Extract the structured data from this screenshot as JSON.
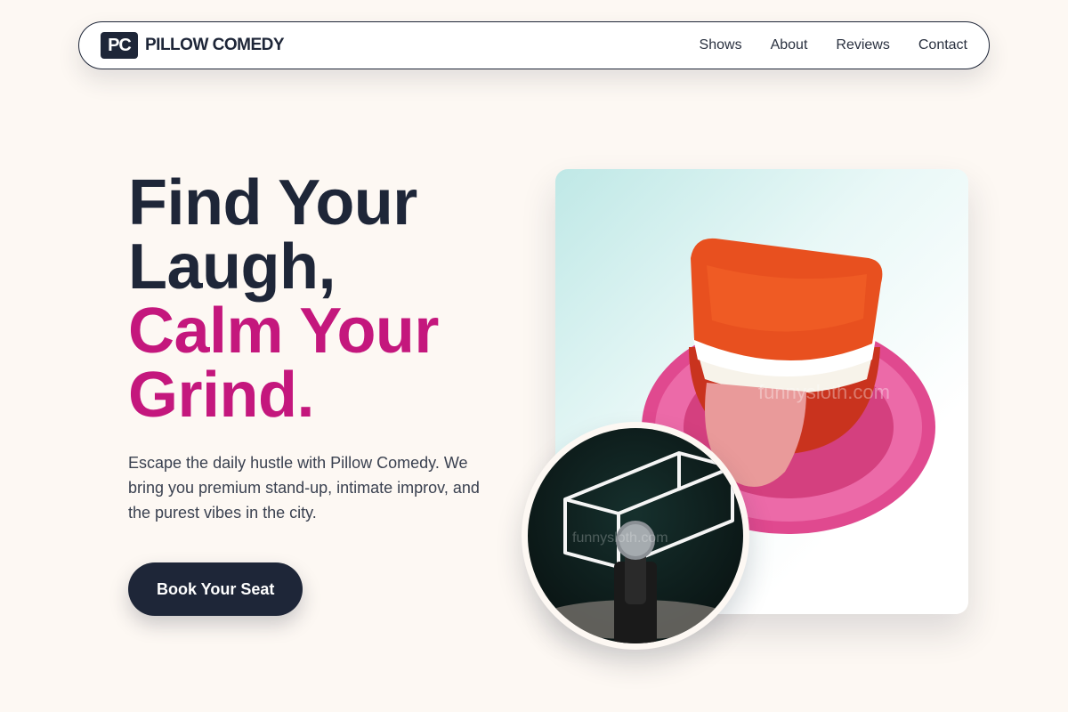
{
  "nav": {
    "logo_mark": "PC",
    "brand": "PILLOW COMEDY",
    "links": [
      "Shows",
      "About",
      "Reviews",
      "Contact"
    ]
  },
  "hero": {
    "headline_line1": "Find Your",
    "headline_line2": "Laugh,",
    "headline_line3": "Calm Your",
    "headline_line4": "Grind.",
    "description": "Escape the daily hustle with Pillow Comedy. We bring you premium stand-up, intimate improv, and the purest vibes in the city.",
    "cta_label": "Book Your Seat"
  },
  "images": {
    "main": "chattering-teeth-toy-on-pink-pillow-image",
    "secondary": "neon-microphone-image",
    "watermark": "funnysloth.com"
  },
  "colors": {
    "background": "#fdf8f3",
    "primary_dark": "#1e2638",
    "accent_pink": "#c4177d"
  }
}
